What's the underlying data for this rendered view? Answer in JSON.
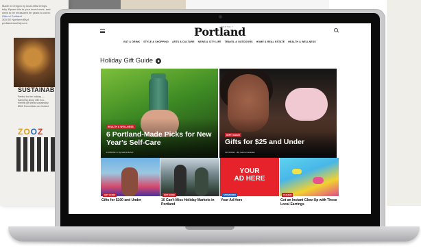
{
  "magazine": {
    "intro_text": "Made in Oregon by local artist brings fully. Bpsen this to your loved ones, and need to be measured for years to come.",
    "contact_lines": [
      "Gifts of Portland",
      "303 SE Northern Blvd",
      "portlandmonthly.com"
    ],
    "heading": "SUSTAINABI",
    "body_text": "Perfect for the holiday — Sampling along with eco-friendly gift ideas sustainably $500 Committees are limited.",
    "zoo_letters": [
      "ZO",
      "O",
      "Z"
    ]
  },
  "website": {
    "masthead_small": "MONTHLY",
    "logo": "Portland",
    "nav": [
      "EAT & DRINK",
      "STYLE & SHOPPING",
      "ARTS & CULTURE",
      "NEWS & CITY LIFE",
      "TRAVEL & OUTDOORS",
      "HOME & REAL ESTATE",
      "HEALTH & WELLNESS"
    ],
    "section_title": "Holiday Gift Guide",
    "features": [
      {
        "badge": "HEALTH & WELLNESS",
        "title": "6 Portland-Made Picks for New Year's Self-Care",
        "byline": "12/28/2021 • By Gabra Behrd"
      },
      {
        "badge": "GIFT GUIDE",
        "title": "Gifts for $25 and Under",
        "byline": "12/10/2021 • By Gabra Castellan"
      }
    ],
    "cards": [
      {
        "badge": "GIFT GUIDE",
        "caption": "Gifts for $100 and Under"
      },
      {
        "badge": "GIFT GUIDE",
        "caption": "10 Can't-Miss Holiday Markets in Portland"
      },
      {
        "badge": "SPONSORED",
        "caption": "Your Ad Here",
        "ad_line1": "YOUR",
        "ad_line2": "AD HERE"
      },
      {
        "badge": "FASHION",
        "caption": "Get an Instant Glow-Up with These Local Earrings"
      }
    ]
  },
  "colors": {
    "badge_red": "#c8202a",
    "sponsored_blue": "#1f5fbf",
    "laptop_silver": "#c9c9cb"
  }
}
